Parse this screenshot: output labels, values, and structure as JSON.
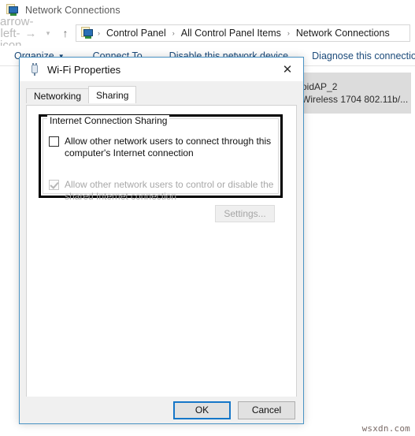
{
  "window": {
    "title": "Network Connections",
    "title_icon": "network-connections-icon"
  },
  "nav": {
    "back_icon": "arrow-left-icon",
    "forward_icon": "arrow-right-icon",
    "recent_icon": "chevron-down-icon",
    "up_icon": "arrow-up-icon",
    "address_icon": "network-connections-icon",
    "breadcrumbs": [
      "Control Panel",
      "All Control Panel Items",
      "Network Connections"
    ],
    "separator": "›"
  },
  "toolbar": {
    "organize": "Organize",
    "organize_caret": "▼",
    "connect_to": "Connect To",
    "disable_device": "Disable this network device",
    "diagnose": "Diagnose this connection"
  },
  "connection_list": {
    "selected": {
      "name": "oidAP_2",
      "adapter": "Wireless 1704 802.11b/..."
    }
  },
  "dialog": {
    "icon": "network-adapter-icon",
    "title": "Wi-Fi Properties",
    "close_label": "✕",
    "tabs": [
      {
        "label": "Networking",
        "active": false
      },
      {
        "label": "Sharing",
        "active": true
      }
    ],
    "sharing": {
      "group_title": "Internet Connection Sharing",
      "checkbox_allow_connect": {
        "label": "Allow other network users to connect through this computer's Internet connection",
        "checked": false,
        "disabled": false
      },
      "checkbox_allow_control": {
        "label": "Allow other network users to control or disable the shared Internet connection",
        "checked": true,
        "disabled": true
      },
      "settings_button": "Settings..."
    },
    "footer": {
      "ok": "OK",
      "cancel": "Cancel"
    }
  },
  "watermark": "wsxdn.com",
  "colors": {
    "accent_blue": "#1576c8",
    "dialog_border": "#4a93c4",
    "link_blue": "#1b4a7a",
    "selection_gray": "#dcdcdc"
  }
}
